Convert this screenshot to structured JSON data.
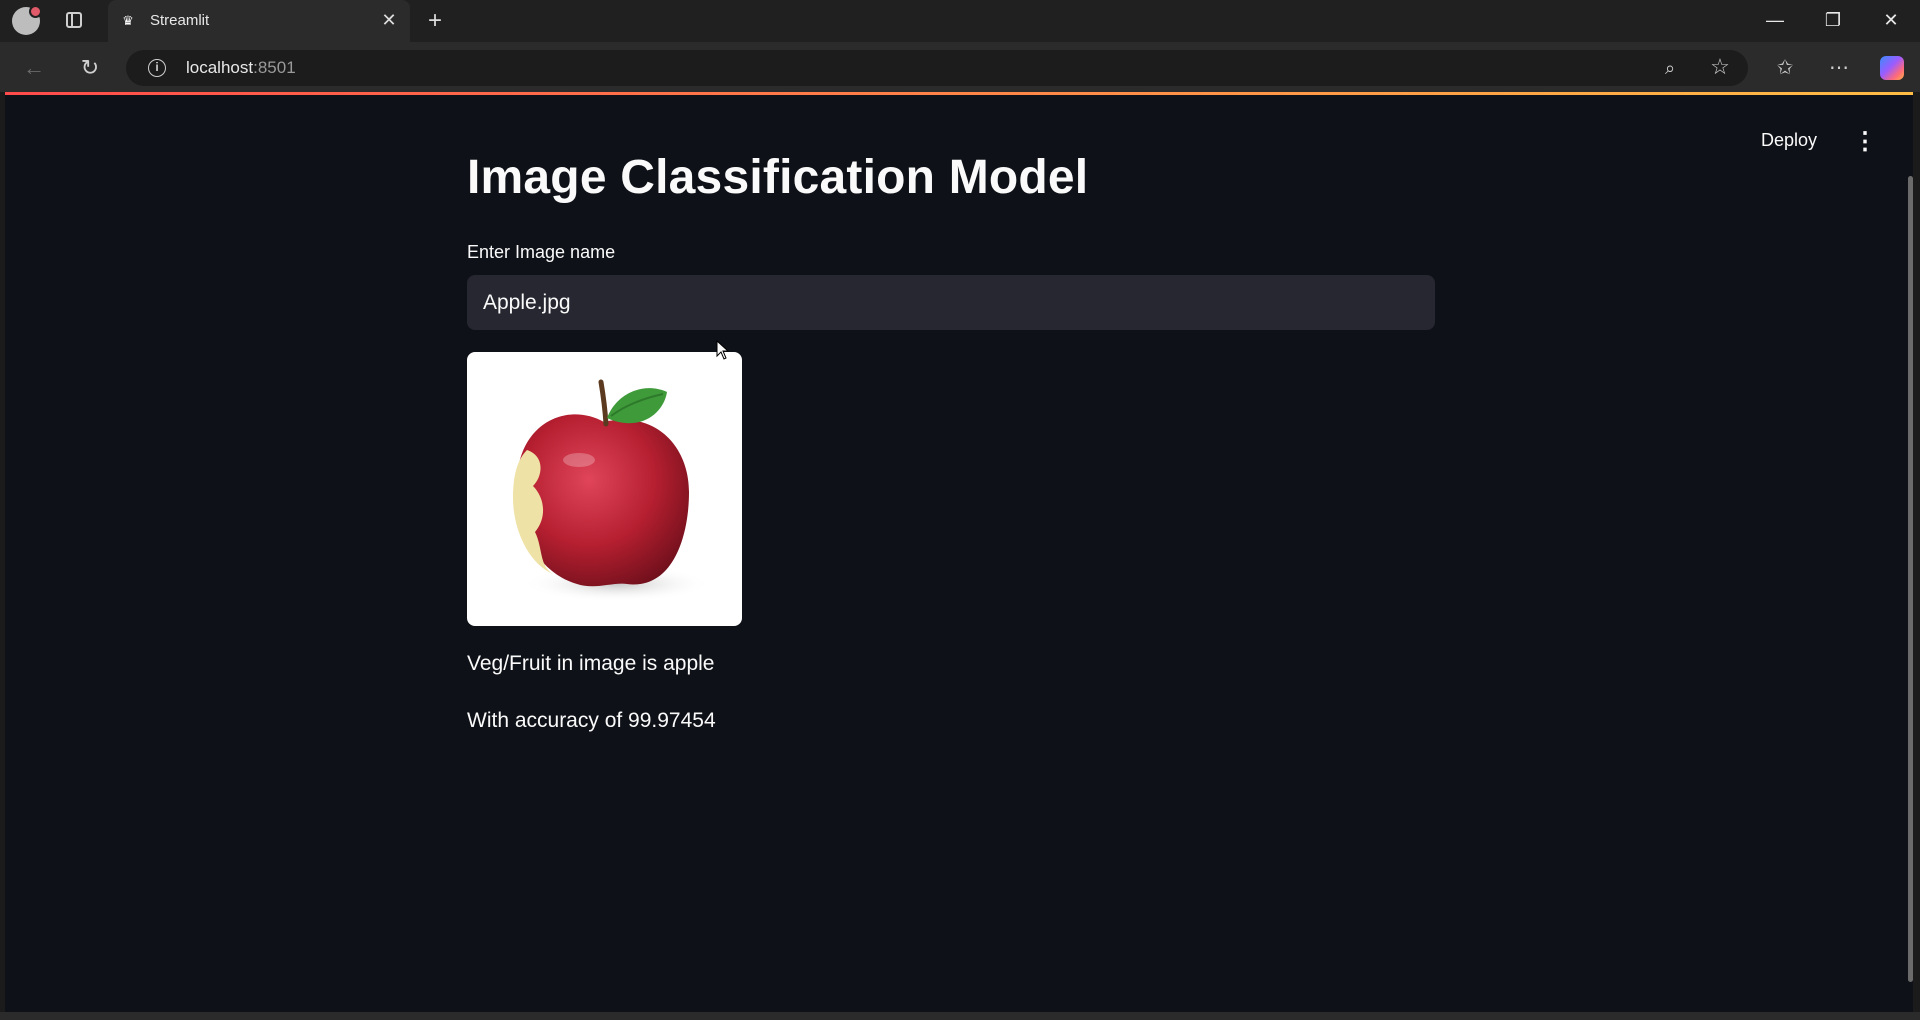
{
  "browser": {
    "tab_title": "Streamlit",
    "url_host": "localhost",
    "url_port": ":8501"
  },
  "app": {
    "deploy_label": "Deploy",
    "title": "Image Classification Model",
    "input_label": "Enter Image name",
    "input_value": "Apple.jpg",
    "result_line": "Veg/Fruit in image is apple",
    "accuracy_line": "With accuracy of 99.97454"
  },
  "colors": {
    "page_bg": "#0e1117",
    "input_bg": "#262730",
    "text": "#fafafa",
    "accent_start": "#ff4b4b",
    "accent_end": "#ffbd45"
  }
}
